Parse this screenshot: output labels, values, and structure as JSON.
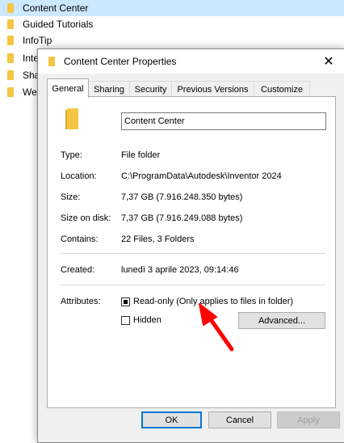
{
  "explorer": {
    "items": [
      {
        "label": "Content Center"
      },
      {
        "label": "Guided Tutorials"
      },
      {
        "label": "InfoTip"
      },
      {
        "label": "Inter"
      },
      {
        "label": "Shar"
      },
      {
        "label": "Web"
      }
    ]
  },
  "dialog": {
    "title": "Content Center Properties",
    "close_glyph": "✕",
    "tabs": [
      {
        "label": "General"
      },
      {
        "label": "Sharing"
      },
      {
        "label": "Security"
      },
      {
        "label": "Previous Versions"
      },
      {
        "label": "Customize"
      }
    ],
    "general": {
      "name": "Content Center",
      "rows": [
        {
          "label": "Type:",
          "value": "File folder"
        },
        {
          "label": "Location:",
          "value": "C:\\ProgramData\\Autodesk\\Inventor 2024"
        },
        {
          "label": "Size:",
          "value": "7,37 GB (7.916.248.350 bytes)"
        },
        {
          "label": "Size on disk:",
          "value": "7,37 GB (7.916.249.088 bytes)"
        },
        {
          "label": "Contains:",
          "value": "22 Files, 3 Folders"
        }
      ],
      "created": {
        "label": "Created:",
        "value": "lunedì 3 aprile 2023, 09:14:46"
      },
      "attributes": {
        "label": "Attributes:",
        "readonly_label": "Read-only (Only applies to files in folder)",
        "readonly_state": "indeterminate",
        "hidden_label": "Hidden",
        "advanced_label": "Advanced..."
      }
    },
    "buttons": {
      "ok": "OK",
      "cancel": "Cancel",
      "apply": "Apply"
    }
  },
  "annotation": {
    "arrow_color": "#ff0000"
  },
  "colors": {
    "folder": "#f4c542",
    "selection": "#cce8ff",
    "accent": "#0078d7"
  }
}
